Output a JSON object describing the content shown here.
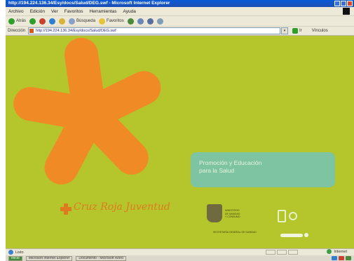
{
  "window": {
    "title": "http://194.224.136.34/Esy/docs/Salud/DEG.swf - Microsoft Internet Explorer"
  },
  "menu": {
    "items": [
      "Archivo",
      "Edición",
      "Ver",
      "Favoritos",
      "Herramientas",
      "Ayuda"
    ]
  },
  "toolbar": {
    "back_label": "Atrás",
    "search_label": "Búsqueda",
    "favorites_label": "Favoritos"
  },
  "address": {
    "label": "Dirección",
    "url": "http://194.224.136.34/Esy/docs/Salud/DEG.swf",
    "go_label": "Ir",
    "links_label": "Vínculos"
  },
  "content": {
    "promo_line1": "Promoción y Educación",
    "promo_line2": "para la Salud",
    "brand_name": "Cruz Roja Juventud",
    "institution_line1": "MINISTERIO",
    "institution_line2": "DE SANIDAD",
    "institution_line3": "Y CONSUMO",
    "institution_line4": "SECRETARÍA GENERAL DE SANIDAD",
    "colors": {
      "background": "#b5c52c",
      "star": "#f08a24",
      "promo_box": "#7ec3a2",
      "brand": "#e07a1f"
    }
  },
  "status": {
    "left_text": "Listo",
    "zone_text": "Internet"
  },
  "taskbar": {
    "items": [
      "Inicio",
      "Microsoft Internet Explorer",
      "Documento - Microsoft Word"
    ]
  }
}
